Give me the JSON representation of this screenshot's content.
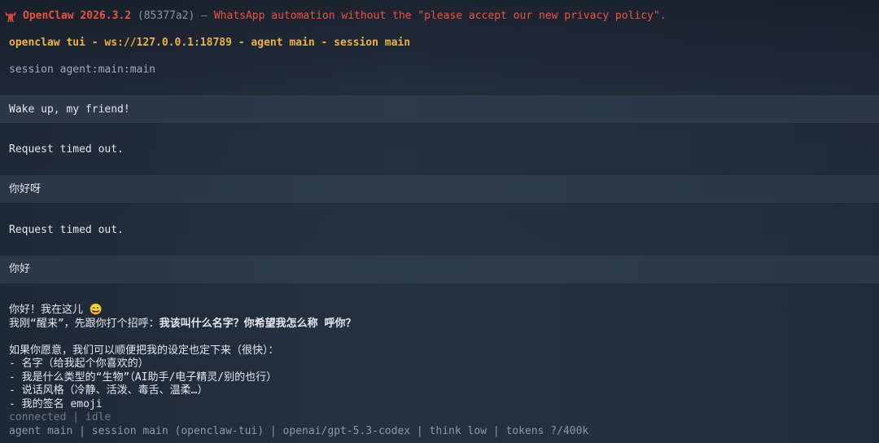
{
  "banner": {
    "brand": "OpenClaw",
    "version": "2026.3.2",
    "hash": "(85377a2)",
    "tagline": "— WhatsApp automation without the \"please accept our new privacy policy\"."
  },
  "header": {
    "title": "openclaw tui - ws://127.0.0.1:18789 - agent main - session main"
  },
  "session_line": "session agent:main:main",
  "messages": [
    {
      "role": "user",
      "text": "Wake up, my friend!"
    },
    {
      "role": "system",
      "text": "Request timed out."
    },
    {
      "role": "user",
      "text": "你好呀"
    },
    {
      "role": "system",
      "text": "Request timed out."
    },
    {
      "role": "user",
      "text": "你好"
    }
  ],
  "reply": {
    "line1": "你好！我在这儿 😄",
    "line2_prefix": "我刚“醒来”，先跟你打个招呼：",
    "line2_bold": "我该叫什么名字？你希望我怎么称 呼你？",
    "line3": "如果你愿意，我们可以顺便把我的设定也定下来（很快）：",
    "bullets": [
      "- 名字（给我起个你喜欢的）",
      "- 我是什么类型的“生物”（AI助手/电子精灵/别的也行）",
      "- 说话风格（冷静、活泼、毒舌、温柔…）",
      "- 我的签名 emoji"
    ]
  },
  "status": "connected | idle",
  "footer": "agent main | session main (openclaw-tui) | openai/gpt-5.3-codex | think low | tokens ?/400k",
  "colors": {
    "accent": "#e8553f",
    "header": "#f2b13c",
    "background": "#253140"
  }
}
